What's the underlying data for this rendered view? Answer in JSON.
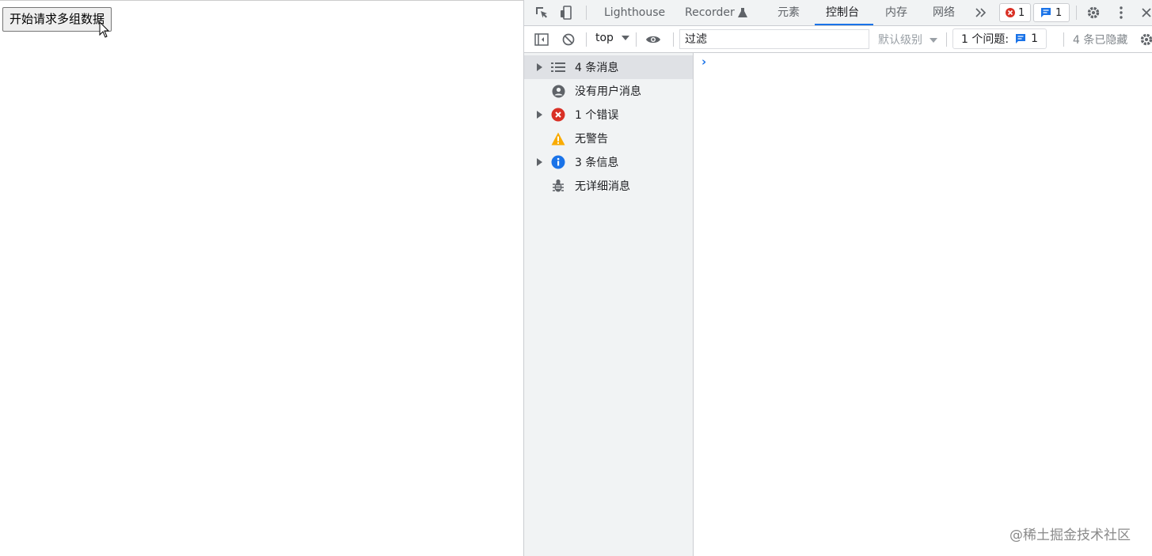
{
  "page": {
    "button_label": "开始请求多组数据"
  },
  "devtools": {
    "tabs": [
      {
        "label": "Lighthouse"
      },
      {
        "label": "Recorder"
      },
      {
        "label": "元素"
      },
      {
        "label": "控制台"
      },
      {
        "label": "内存"
      },
      {
        "label": "网络"
      }
    ],
    "error_badge_count": "1",
    "message_badge_count": "1",
    "toolbar": {
      "context": "top",
      "filter_placeholder": "过滤",
      "levels": "默认级别",
      "issues_label": "1 个问题:",
      "issues_count": "1",
      "hidden_count": "4 条已隐藏"
    },
    "sidebar": [
      {
        "label": "4 条消息",
        "icon": "list-icon"
      },
      {
        "label": "没有用户消息",
        "icon": "user-icon"
      },
      {
        "label": "1 个错误",
        "icon": "error-icon"
      },
      {
        "label": "无警告",
        "icon": "warning-icon"
      },
      {
        "label": "3 条信息",
        "icon": "info-icon"
      },
      {
        "label": "无详细消息",
        "icon": "bug-icon"
      }
    ]
  },
  "watermark": "@稀土掘金技术社区",
  "colors": {
    "accent": "#1a73e8",
    "error": "#d93025",
    "warning": "#f9ab00",
    "info": "#1a73e8"
  }
}
